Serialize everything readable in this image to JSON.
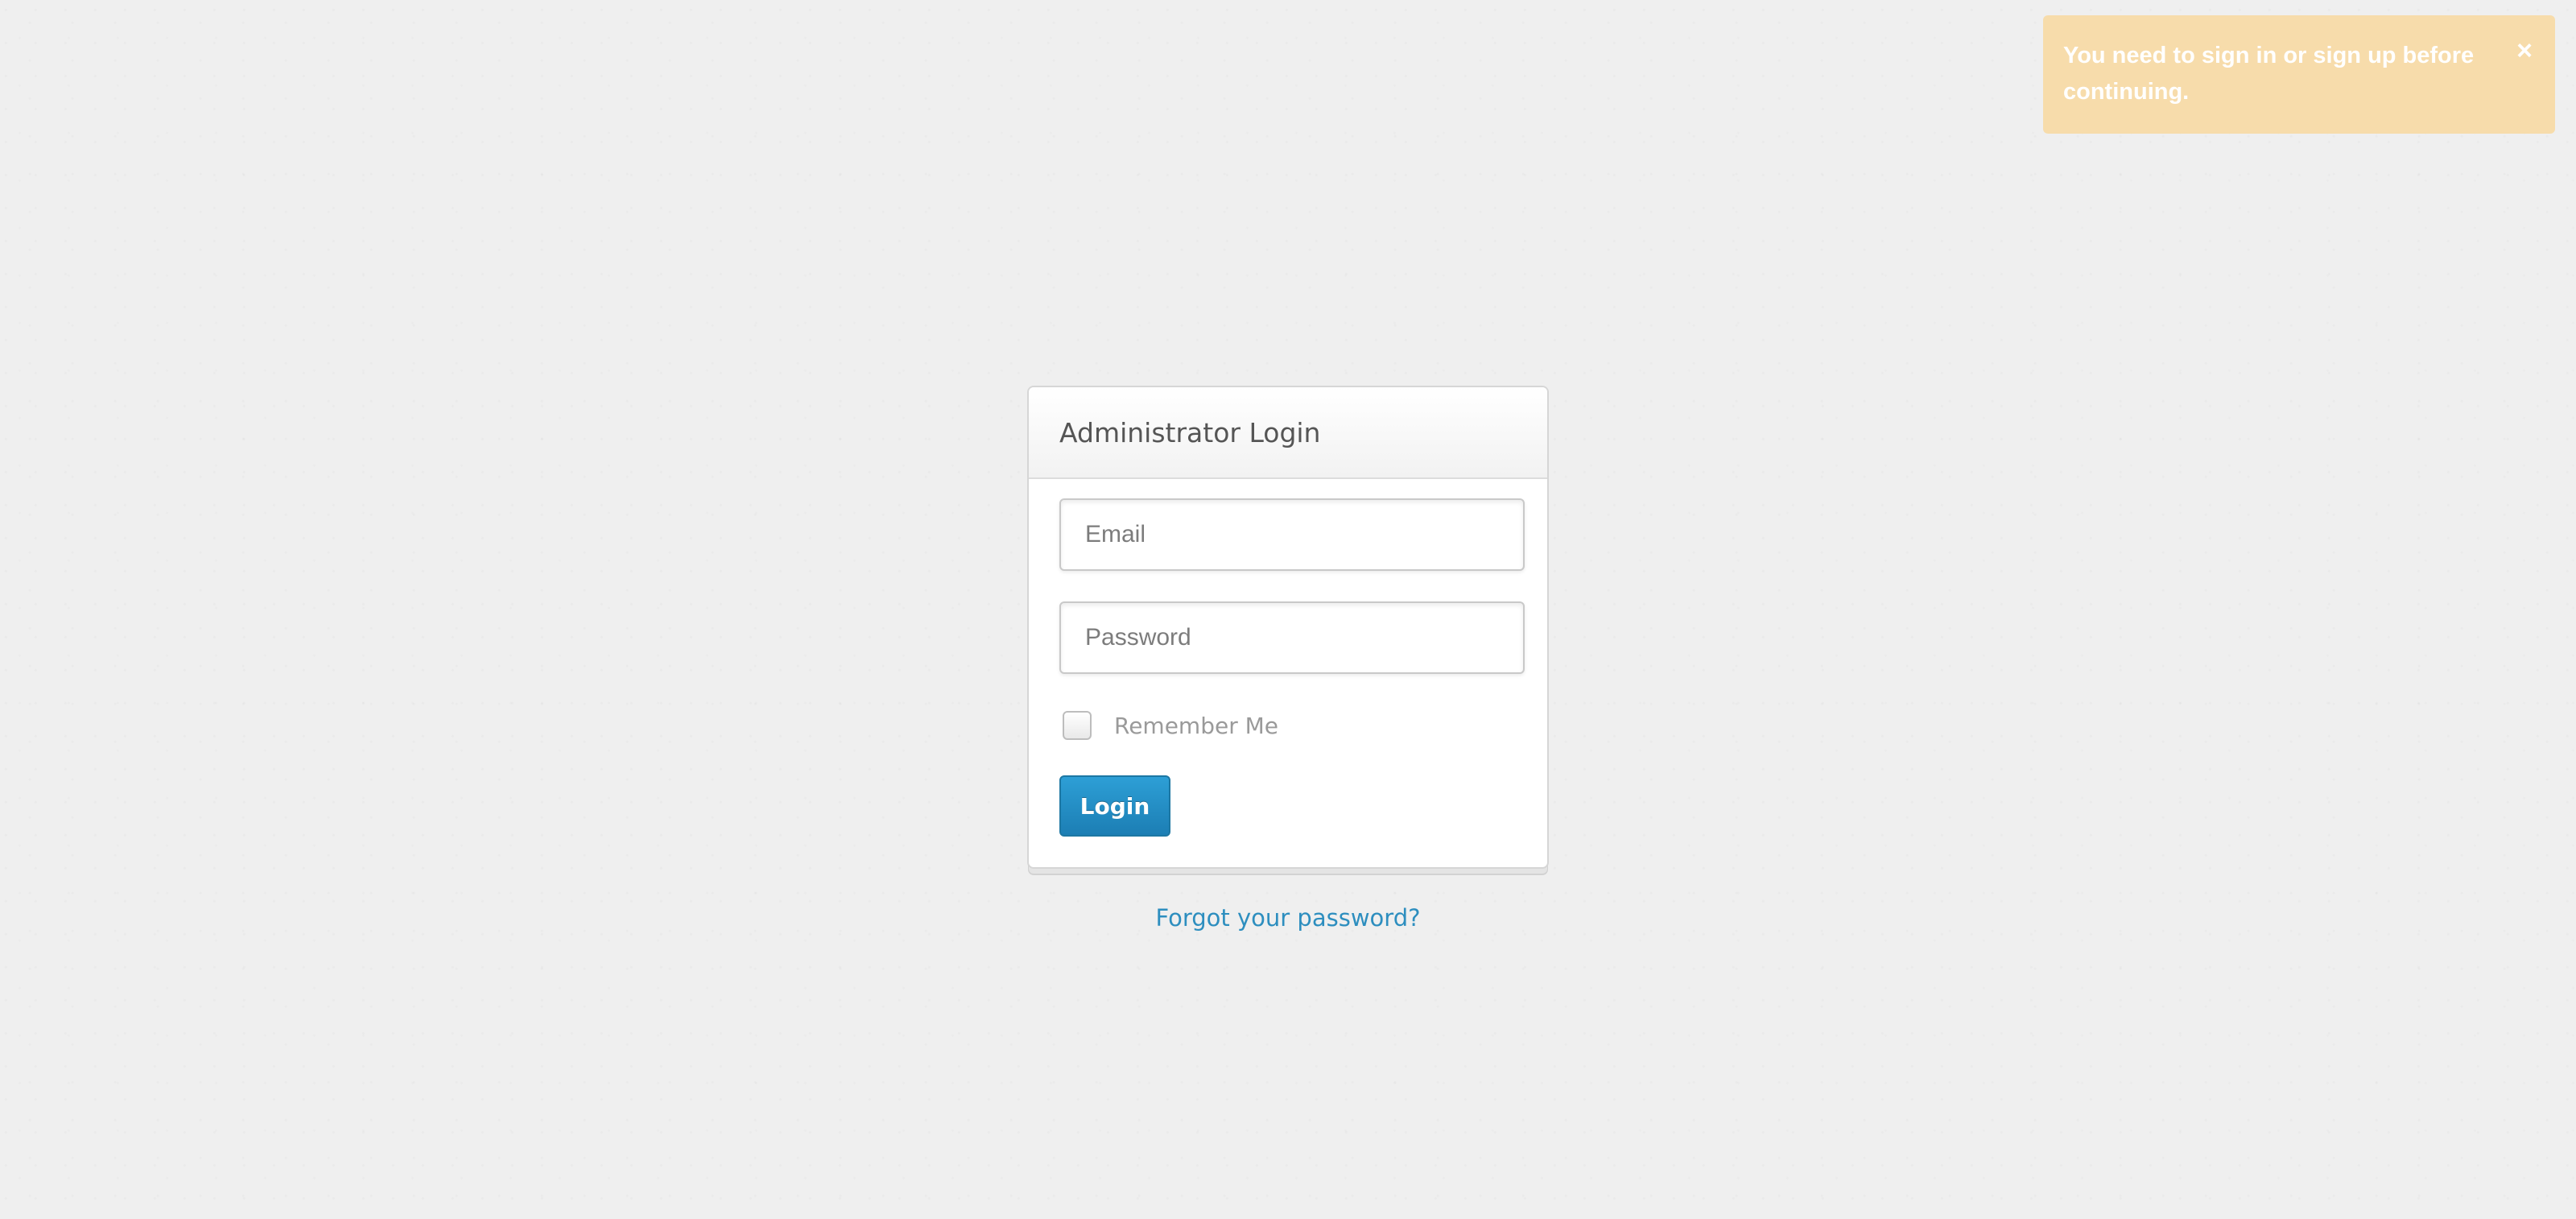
{
  "flash": {
    "message": "You need to sign in or sign up before continuing.",
    "close_label": "×"
  },
  "login": {
    "title": "Administrator Login",
    "email_placeholder": "Email",
    "password_placeholder": "Password",
    "remember_label": "Remember Me",
    "submit_label": "Login"
  },
  "forgot_password": "Forgot your password?",
  "colors": {
    "flash_background": "#f7dcab",
    "primary_button": "#2590c8",
    "link": "#2d8ebf"
  }
}
